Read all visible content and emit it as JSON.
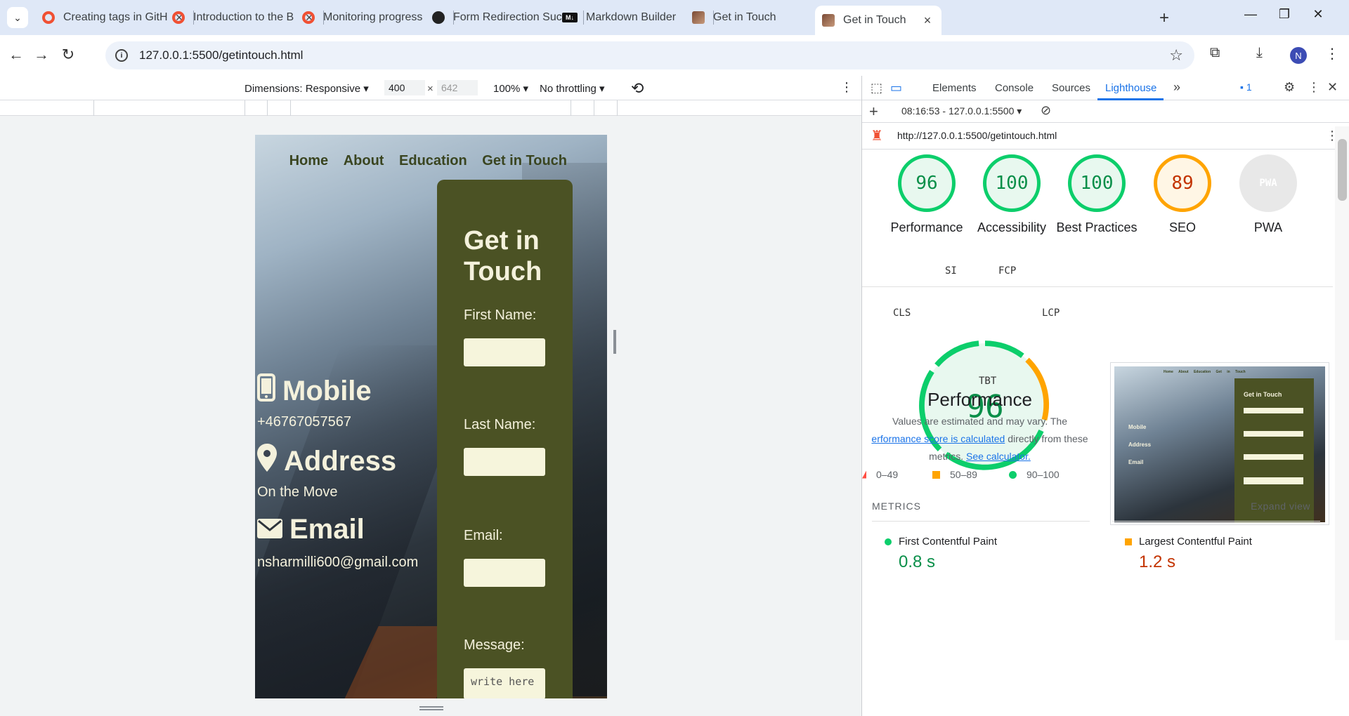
{
  "browser": {
    "tabs": [
      {
        "title": "Creating tags in GitH",
        "icon": "git-icon"
      },
      {
        "title": "Introduction to the B",
        "icon": "git-icon"
      },
      {
        "title": "Monitoring progress",
        "icon": "git-icon"
      },
      {
        "title": "Form Redirection Suc",
        "icon": "openai-icon"
      },
      {
        "title": "Markdown Builder",
        "icon": "markdown-icon"
      },
      {
        "title": "Get in Touch",
        "icon": "photo-icon"
      },
      {
        "title": "Get in Touch",
        "icon": "photo-icon",
        "active": true
      }
    ],
    "url": "127.0.0.1:5500/getintouch.html",
    "profile_initial": "N"
  },
  "device_toolbar": {
    "dimensions_label": "Dimensions: Responsive",
    "width": "400",
    "height": "642",
    "times": "×",
    "zoom": "100%",
    "throttling": "No throttling"
  },
  "site": {
    "nav": [
      "Home",
      "About",
      "Education",
      "Get in Touch"
    ],
    "mobile_heading": "Mobile",
    "mobile_value": "+46767057567",
    "address_heading": "Address",
    "address_value": "On the Move",
    "email_heading": "Email",
    "email_value": "nsharmilli600@gmail.com",
    "form_title": "Get in Touch",
    "first_name_label": "First Name:",
    "last_name_label": "Last Name:",
    "email_label": "Email:",
    "message_label": "Message:",
    "message_placeholder": "write here"
  },
  "devtools": {
    "tabs": [
      "Elements",
      "Console",
      "Sources",
      "Lighthouse"
    ],
    "active_tab": "Lighthouse",
    "issues_count": "1",
    "report_label": "08:16:53 - 127.0.0.1:5500",
    "report_url": "http://127.0.0.1:5500/getintouch.html",
    "scores": [
      {
        "label": "Performance",
        "value": "96",
        "status": "good"
      },
      {
        "label": "Accessibility",
        "value": "100",
        "status": "good"
      },
      {
        "label": "Best Practices",
        "value": "100",
        "status": "good"
      },
      {
        "label": "SEO",
        "value": "89",
        "status": "average"
      },
      {
        "label": "PWA",
        "value": "PWA",
        "status": "na"
      }
    ],
    "perf_score": "96",
    "perf_title": "Performance",
    "metric_abbr": {
      "si": "SI",
      "fcp": "FCP",
      "cls": "CLS",
      "lcp": "LCP",
      "tbt": "TBT"
    },
    "note_1": "Values are estimated and may vary. The",
    "note_link": "erformance score is calculated",
    "note_2": "directly from these",
    "note_3": "metrics.",
    "note_calc": "See calculator.",
    "legend": [
      {
        "range": "0–49",
        "color": "#ff4e42"
      },
      {
        "range": "50–89",
        "color": "#ffa400"
      },
      {
        "range": "90–100",
        "color": "#0cce6b"
      }
    ],
    "metrics_title": "METRICS",
    "expand_view": "Expand view",
    "metrics": [
      {
        "name": "First Contentful Paint",
        "value": "0.8 s",
        "color": "#0a8f49"
      },
      {
        "name": "Largest Contentful Paint",
        "value": "1.2 s",
        "color": "#c33300"
      }
    ],
    "thumb": {
      "nav": [
        "Home",
        "About",
        "Education",
        "Get in Touch"
      ],
      "form_title": "Get in Touch",
      "mobile": "Mobile",
      "address": "Address",
      "email": "Email"
    }
  }
}
